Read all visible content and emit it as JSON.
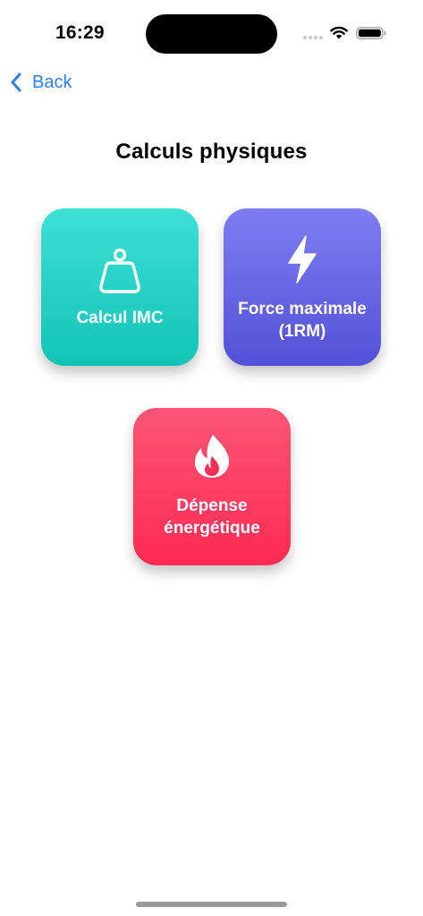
{
  "status_bar": {
    "time": "16:29"
  },
  "nav": {
    "back_label": "Back"
  },
  "page": {
    "title": "Calculs physiques"
  },
  "tiles": [
    {
      "label": "Calcul IMC",
      "icon": "scale-weight-icon",
      "color_top": "#3ee0d4",
      "color_bottom": "#12c4b6"
    },
    {
      "label": "Force maximale (1RM)",
      "icon": "bolt-icon",
      "color_top": "#7d7ef2",
      "color_bottom": "#5450d6"
    },
    {
      "label": "Dépense énergétique",
      "icon": "flame-icon",
      "color_top": "#fb5575",
      "color_bottom": "#ff2a54"
    }
  ],
  "colors": {
    "accent": "#2f80ed"
  }
}
